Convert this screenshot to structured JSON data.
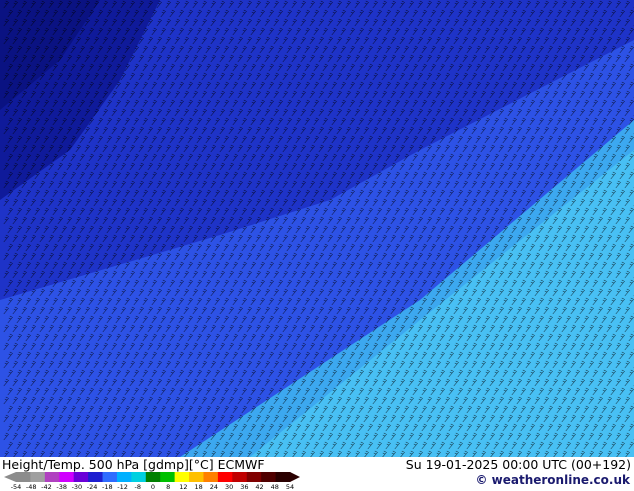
{
  "footer": {
    "title": "Height/Temp. 500 hPa [gdmp][°C] ECMWF",
    "datetime": "Su 19-01-2025 00:00 UTC (00+192)",
    "credit": "© weatheronline.co.uk"
  },
  "legend": {
    "ticks": [
      "-54",
      "-48",
      "-42",
      "-38",
      "-30",
      "-24",
      "-18",
      "-12",
      "-8",
      "0",
      "8",
      "12",
      "18",
      "24",
      "30",
      "36",
      "42",
      "48",
      "54"
    ],
    "colors": [
      "#8c8c8c",
      "#a0a0a0",
      "#b040c0",
      "#d000ff",
      "#6a00d8",
      "#1e1ed0",
      "#2f6cff",
      "#00b0ff",
      "#00d0e0",
      "#008000",
      "#00c000",
      "#ffff00",
      "#ffc000",
      "#ff8000",
      "#ff0000",
      "#c00000",
      "#800000",
      "#500000",
      "#2a0000"
    ]
  },
  "map": {
    "colors": {
      "dark_blue": "#0a1282",
      "mid_blue": "#1e33c8",
      "blue": "#2d52e6",
      "light_blue": "#3ca8f0",
      "cyan": "#48c0f4",
      "barb": "#000000"
    }
  }
}
